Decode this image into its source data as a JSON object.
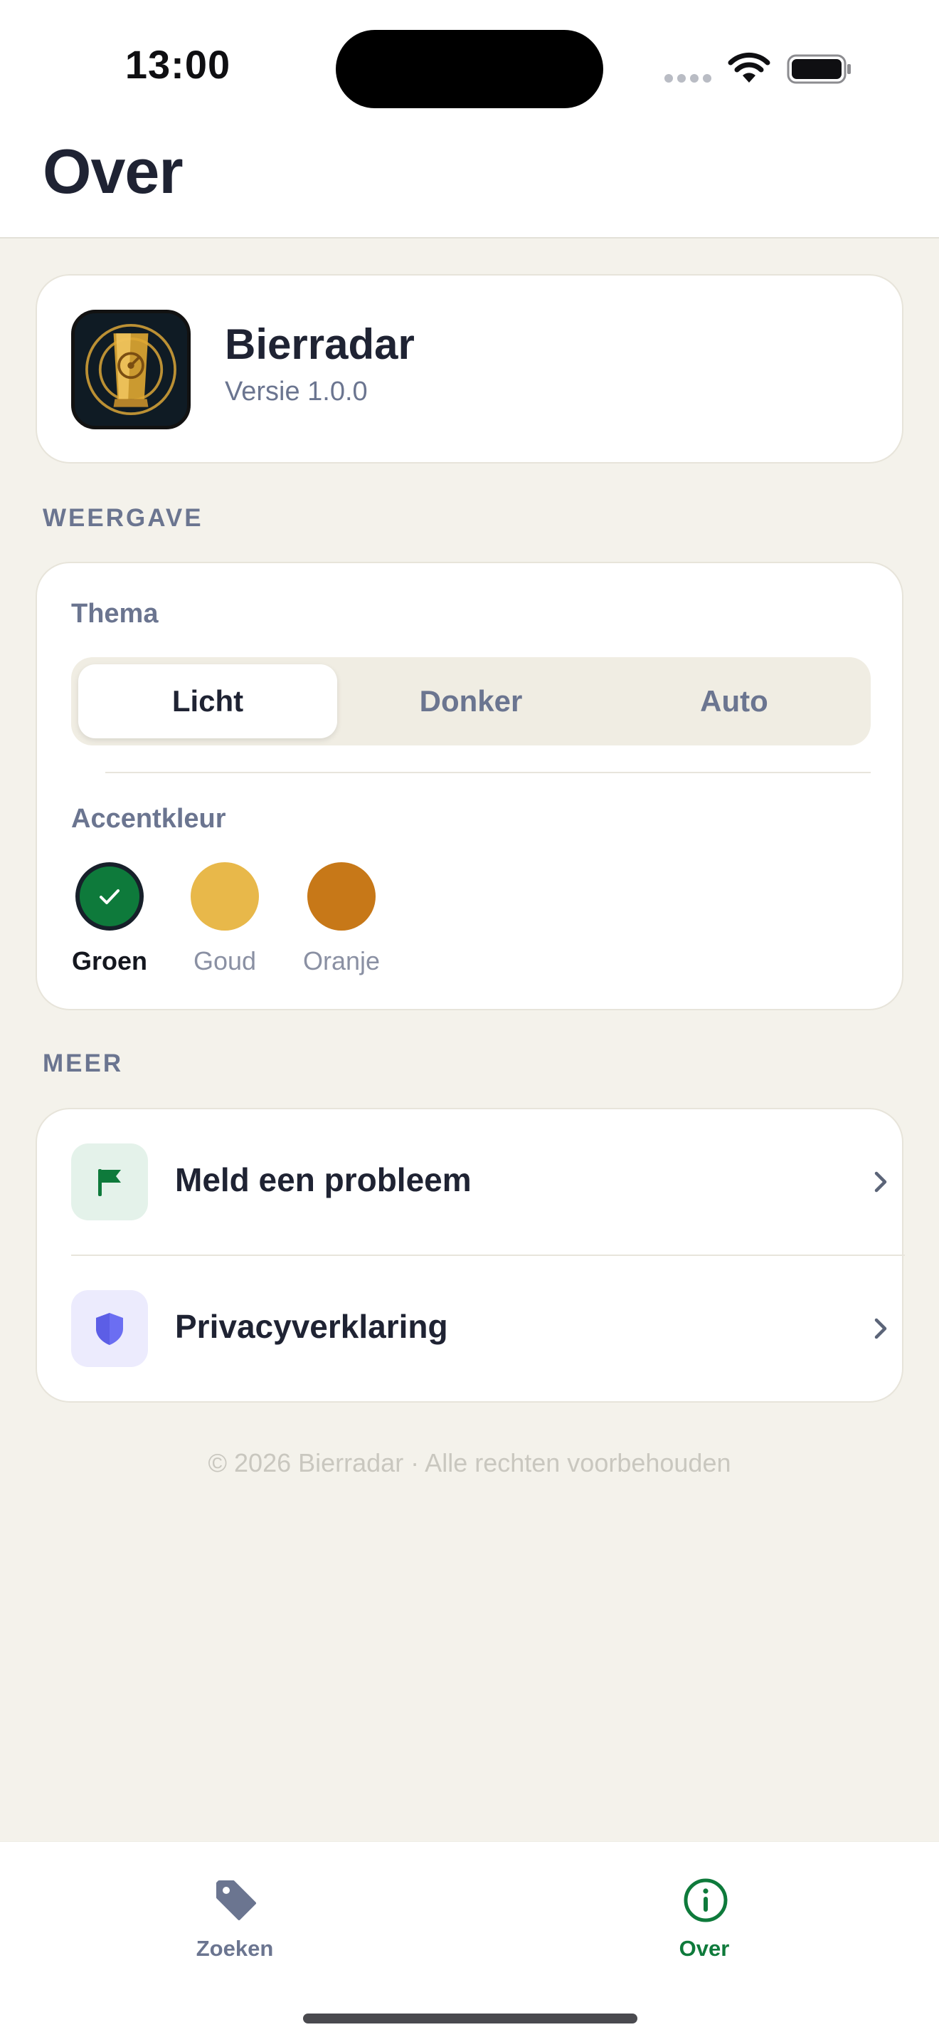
{
  "status_bar": {
    "time": "13:00"
  },
  "header": {
    "title": "Over"
  },
  "app_info": {
    "name": "Bierradar",
    "version": "Versie 1.0.0",
    "icon": "radar-beer-glass-icon"
  },
  "sections": {
    "display": {
      "label": "WEERGAVE",
      "theme_label": "Thema",
      "theme_options": [
        "Licht",
        "Donker",
        "Auto"
      ],
      "theme_selected": "Licht",
      "accent_label": "Accentkleur",
      "accent_options": [
        {
          "label": "Groen",
          "color": "#0e7a3b",
          "selected": true
        },
        {
          "label": "Goud",
          "color": "#e8b84a",
          "selected": false
        },
        {
          "label": "Oranje",
          "color": "#c77818",
          "selected": false
        }
      ]
    },
    "more": {
      "label": "MEER",
      "items": [
        {
          "label": "Meld een probleem",
          "icon": "flag-icon",
          "icon_color": "#0e7a3b"
        },
        {
          "label": "Privacyverklaring",
          "icon": "shield-icon",
          "icon_color": "#6b6ef2"
        }
      ]
    }
  },
  "footer": {
    "text": "© 2026 Bierradar · Alle rechten voorbehouden"
  },
  "tab_bar": {
    "tabs": [
      {
        "label": "Zoeken",
        "icon": "tag-icon",
        "active": false
      },
      {
        "label": "Over",
        "icon": "info-icon",
        "active": true
      }
    ],
    "active_color": "#0e7a3b",
    "inactive_color": "#6b7590"
  }
}
